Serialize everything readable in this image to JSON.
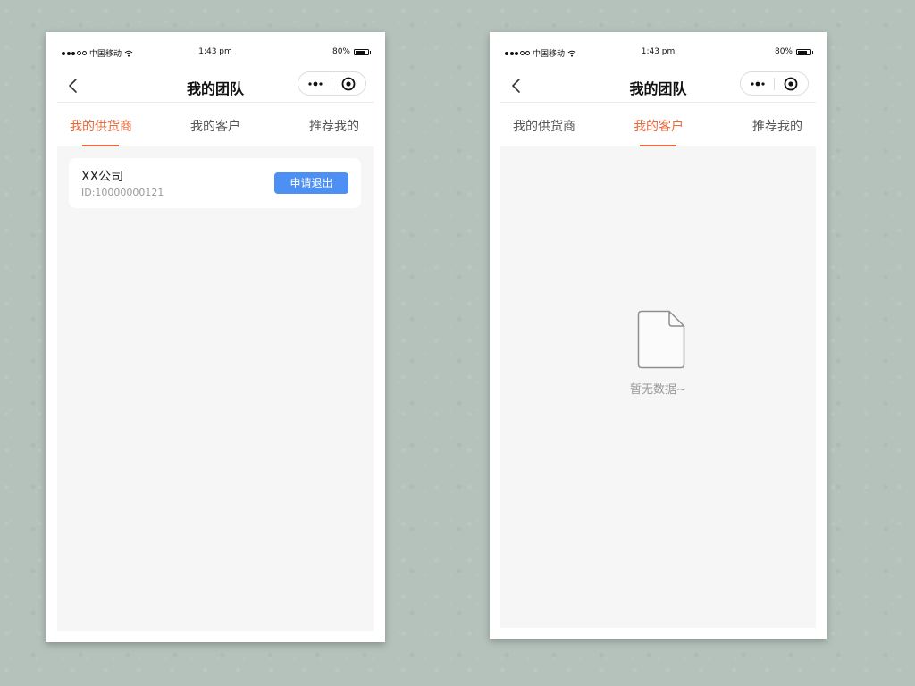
{
  "phones": [
    {
      "status": {
        "carrier": "中国移动",
        "time": "1:43 pm",
        "battery": "80%",
        "battery_level": 0.8
      },
      "nav": {
        "title": "我的团队"
      },
      "tabs": [
        {
          "label": "我的供货商",
          "active": true
        },
        {
          "label": "我的客户",
          "active": false
        },
        {
          "label": "推荐我的",
          "active": false
        }
      ],
      "list": [
        {
          "name": "XX公司",
          "id": "ID:10000000121",
          "action_label": "申请退出"
        }
      ]
    },
    {
      "status": {
        "carrier": "中国移动",
        "time": "1:43 pm",
        "battery": "80%",
        "battery_level": 0.8
      },
      "nav": {
        "title": "我的团队"
      },
      "tabs": [
        {
          "label": "我的供货商",
          "active": false
        },
        {
          "label": "我的客户",
          "active": true
        },
        {
          "label": "推荐我的",
          "active": false
        }
      ],
      "empty_state": {
        "text": "暂无数据~",
        "icon": "file-icon"
      }
    }
  ],
  "colors": {
    "accent": "#e8693c",
    "button": "#4d8ff2",
    "content_bg": "#f6f6f6",
    "backdrop": "#b5c2bb"
  }
}
